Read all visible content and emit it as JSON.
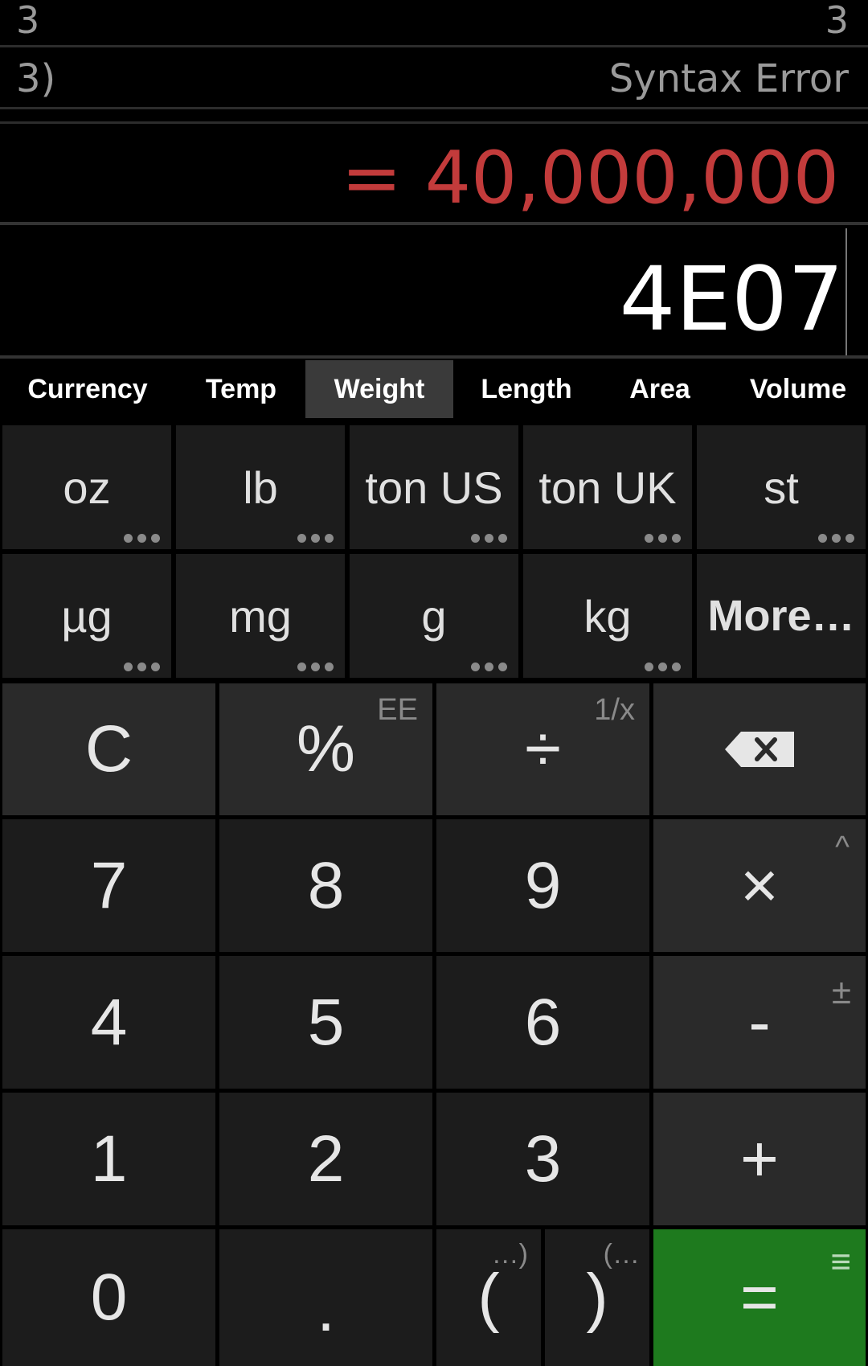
{
  "history": [
    {
      "expression": "3",
      "result": "3"
    },
    {
      "expression": "3)",
      "result": "Syntax Error"
    }
  ],
  "result": "= 40,000,000",
  "input": "4E07",
  "tabs": [
    {
      "label": "Currency"
    },
    {
      "label": "Temp"
    },
    {
      "label": "Weight",
      "active": true
    },
    {
      "label": "Length"
    },
    {
      "label": "Area"
    },
    {
      "label": "Volume"
    }
  ],
  "units": [
    {
      "label": "oz"
    },
    {
      "label": "lb"
    },
    {
      "label": "ton US"
    },
    {
      "label": "ton UK"
    },
    {
      "label": "st"
    },
    {
      "label": "µg"
    },
    {
      "label": "mg"
    },
    {
      "label": "g"
    },
    {
      "label": "kg"
    },
    {
      "label": "More…"
    }
  ],
  "keys": {
    "clear": "C",
    "percent": "%",
    "percent_alt": "EE",
    "divide": "÷",
    "divide_alt": "1/x",
    "seven": "7",
    "eight": "8",
    "nine": "9",
    "multiply": "×",
    "multiply_alt": "^",
    "four": "4",
    "five": "5",
    "six": "6",
    "minus": "-",
    "minus_alt": "±",
    "one": "1",
    "two": "2",
    "three": "3",
    "plus": "+",
    "zero": "0",
    "decimal": ".",
    "open_paren": "(",
    "open_paren_alt": "…)",
    "close_paren": ")",
    "close_paren_alt": "(…",
    "equals": "=",
    "equals_alt": "≡"
  },
  "colors": {
    "result": "#c23b3b",
    "equals_key": "#1e7a1e",
    "active_tab": "#3a3a3a"
  },
  "icons": {
    "backspace": "backspace-icon"
  }
}
